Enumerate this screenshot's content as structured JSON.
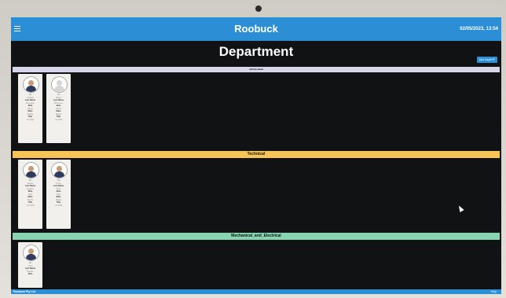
{
  "app": {
    "title": "Roobuck",
    "datetime": "02/05/2023, 13:54",
    "page_title": "Department",
    "add_button": "Add Dept/HF",
    "footer_left": "Roobuck Pty Ltd",
    "footer_right": "Help"
  },
  "colors": {
    "topbar": "#2c8fd6",
    "background": "#101214",
    "technical": "#f7c457",
    "mechanical": "#86d4b0",
    "admin": "#d7d5e9"
  },
  "sections": [
    {
      "name": "Admin-Head",
      "cards": [
        {
          "avatar": "person-icon",
          "lines": [
            "101",
            "Andrew",
            "Last Name",
            "Frampton",
            "Role",
            "Admin",
            "Mine",
            "Rights",
            "Title",
            "On Shift"
          ]
        },
        {
          "avatar": "person-blank-icon",
          "lines": [
            "102",
            "Sarah",
            "Last Name",
            "Whitmore",
            "Role",
            "Admin",
            "Mine",
            "Rights",
            "Title",
            "On Shift"
          ]
        }
      ]
    },
    {
      "name": "Technical",
      "cards": [
        {
          "avatar": "person-icon",
          "lines": [
            "201",
            "Daniel",
            "Last Name",
            "Hughes",
            "Role",
            "Tech",
            "Mine",
            "Rights",
            "Title",
            "On Shift"
          ]
        },
        {
          "avatar": "person-icon",
          "lines": [
            "202",
            "Kevin",
            "Last Name",
            "Chen",
            "Role",
            "Tech",
            "Mine",
            "Rights",
            "Title",
            "On Shift"
          ]
        }
      ]
    },
    {
      "name": "Mechanical_and_Electrical",
      "cards": [
        {
          "avatar": "person-icon",
          "lines": [
            "301",
            "Liam",
            "Last Name",
            "Brooks",
            "Role"
          ]
        }
      ]
    }
  ]
}
